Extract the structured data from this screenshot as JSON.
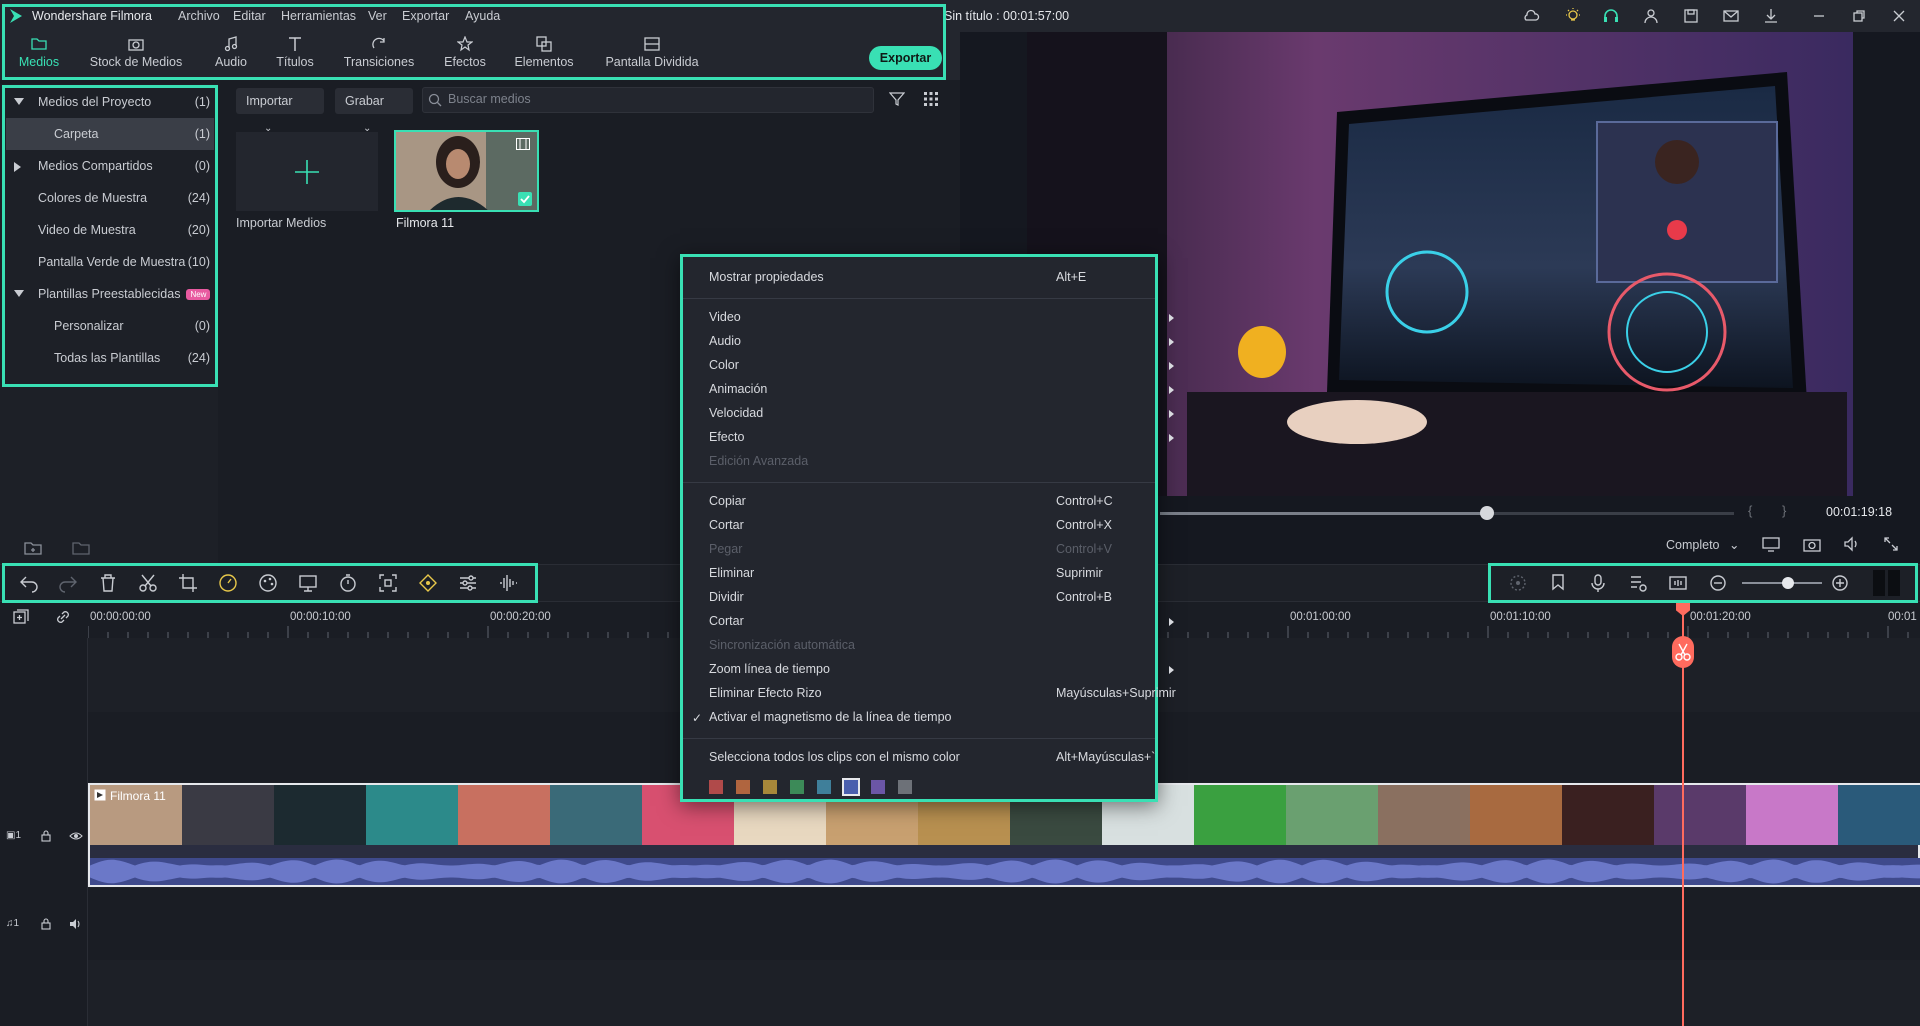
{
  "app": {
    "name": "Wondershare Filmora",
    "menu": [
      "Archivo",
      "Editar",
      "Herramientas",
      "Ver",
      "Exportar",
      "Ayuda"
    ],
    "doc_title": "Sin título : 00:01:57:00"
  },
  "tabs": [
    {
      "label": "Medios",
      "icon": "folder-icon",
      "active": true
    },
    {
      "label": "Stock de Medios",
      "icon": "camera-icon"
    },
    {
      "label": "Audio",
      "icon": "music-note-icon"
    },
    {
      "label": "Títulos",
      "icon": "text-icon"
    },
    {
      "label": "Transiciones",
      "icon": "transition-icon"
    },
    {
      "label": "Efectos",
      "icon": "effects-icon"
    },
    {
      "label": "Elementos",
      "icon": "elements-icon"
    },
    {
      "label": "Pantalla Dividida",
      "icon": "split-screen-icon"
    }
  ],
  "export_label": "Exportar",
  "library": [
    {
      "label": "Medios del Proyecto",
      "count": "(1)",
      "expand": "down"
    },
    {
      "label": "Carpeta",
      "count": "(1)",
      "selected": true,
      "indent": 2
    },
    {
      "label": "Medios Compartidos",
      "count": "(0)",
      "expand": "right"
    },
    {
      "label": "Colores de Muestra",
      "count": "(24)"
    },
    {
      "label": "Video de Muestra",
      "count": "(20)"
    },
    {
      "label": "Pantalla Verde de Muestra",
      "count": "(10)"
    },
    {
      "label": "Plantillas Preestablecidas",
      "count": "",
      "expand": "down",
      "badge": "New"
    },
    {
      "label": "Personalizar",
      "count": "(0)",
      "indent": 1
    },
    {
      "label": "Todas las Plantillas",
      "count": "(24)",
      "indent": 1
    }
  ],
  "media": {
    "import_dropdown": "Importar",
    "record_dropdown": "Grabar",
    "search_placeholder": "Buscar medios",
    "import_tile_label": "Importar Medios",
    "clip_label": "Filmora 11"
  },
  "preview": {
    "time": "00:01:19:18",
    "quality": "Completo",
    "progress": 0.57
  },
  "timeline": {
    "ticks": [
      "00:00:00:00",
      "00:00:10:00",
      "00:00:20:00",
      "00:01:00:00",
      "00:01:10:00",
      "00:01:20:00",
      "00:01"
    ],
    "clip_title": "Filmora 11",
    "video_track_label": "1",
    "audio_track_label": "1"
  },
  "context_menu": {
    "items": [
      {
        "label": "Mostrar propiedades",
        "shortcut": "Alt+E"
      },
      {
        "sep": true
      },
      {
        "label": "Video",
        "submenu": true
      },
      {
        "label": "Audio",
        "submenu": true
      },
      {
        "label": "Color",
        "submenu": true
      },
      {
        "label": "Animación",
        "submenu": true
      },
      {
        "label": "Velocidad",
        "submenu": true
      },
      {
        "label": "Efecto",
        "submenu": true
      },
      {
        "label": "Edición Avanzada",
        "disabled": true
      },
      {
        "sep": true
      },
      {
        "label": "Copiar",
        "shortcut": "Control+C"
      },
      {
        "label": "Cortar",
        "shortcut": "Control+X"
      },
      {
        "label": "Pegar",
        "shortcut": "Control+V",
        "disabled": true
      },
      {
        "label": "Eliminar",
        "shortcut": "Suprimir"
      },
      {
        "label": "Dividir",
        "shortcut": "Control+B"
      },
      {
        "label": "Cortar",
        "submenu": true
      },
      {
        "label": "Sincronización automática",
        "disabled": true
      },
      {
        "label": "Zoom línea de tiempo",
        "submenu": true
      },
      {
        "label": "Eliminar Efecto Rizo",
        "shortcut": "Mayúsculas+Suprimir"
      },
      {
        "label": "Activar el magnetismo de la línea de tiempo",
        "checked": true
      },
      {
        "sep": true
      },
      {
        "label": "Selecciona todos los clips con el mismo color",
        "shortcut": "Alt+Mayúsculas+`"
      }
    ],
    "swatches": [
      "#b04a4a",
      "#b0653f",
      "#a8883a",
      "#3c8a58",
      "#3f7f9a",
      "#4a5fae",
      "#6b56a6",
      "#6d7178"
    ]
  },
  "colors": {
    "accent": "#39e0b4",
    "playhead": "#ff6b5e"
  }
}
